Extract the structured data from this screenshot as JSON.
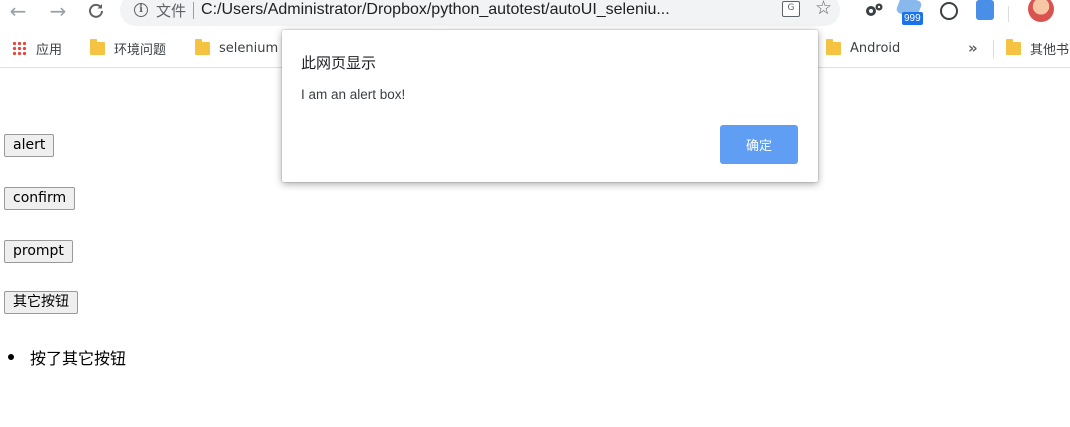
{
  "browser": {
    "nav": {
      "back_icon": "←",
      "forward_icon": "→",
      "reload_icon": "C"
    },
    "address_bar": {
      "scheme_label": "文件",
      "url": "C:/Users/Administrator/Dropbox/python_autotest/autoUI_seleniu..."
    },
    "extensions": {
      "badge_count": "999"
    }
  },
  "bookmarks": {
    "items": [
      {
        "label": "应用",
        "icon": "apps-grid-icon"
      },
      {
        "label": "环境问题",
        "icon": "folder-icon"
      },
      {
        "label": "selenium",
        "icon": "folder-icon"
      },
      {
        "label": "Android",
        "icon": "folder-icon"
      }
    ],
    "overflow_label": "»",
    "other_label": "其他书"
  },
  "page": {
    "buttons": [
      {
        "label": "alert"
      },
      {
        "label": "confirm"
      },
      {
        "label": "prompt"
      },
      {
        "label": "其它按钮"
      }
    ],
    "list_items": [
      "按了其它按钮"
    ]
  },
  "dialog": {
    "title": "此网页显示",
    "message": "I am an alert box!",
    "ok_label": "确定"
  },
  "colors": {
    "dialog_button": "#5f9ef2",
    "folder": "#f5c242",
    "badge": "#1a73e8"
  }
}
